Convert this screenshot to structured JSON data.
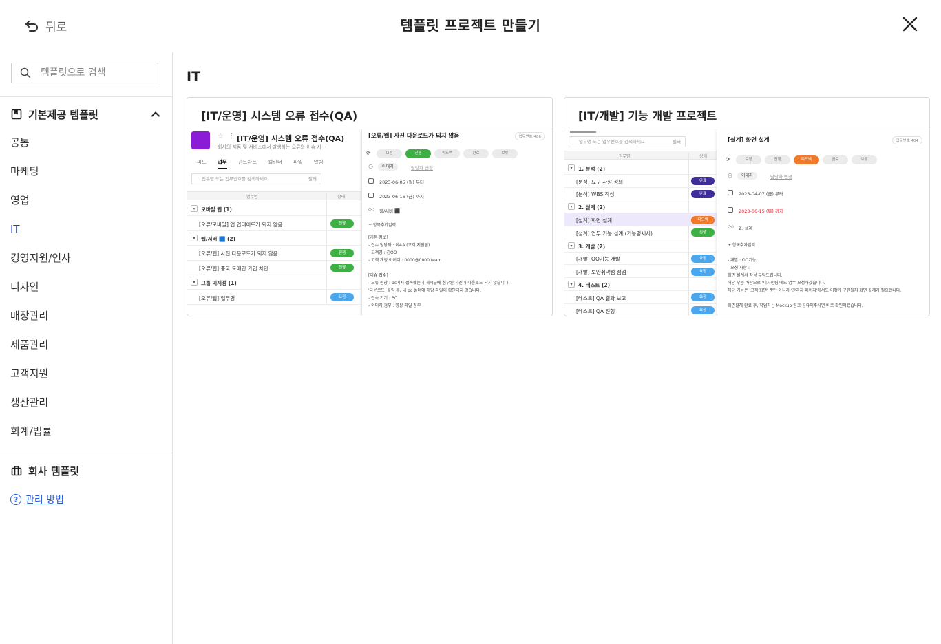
{
  "header": {
    "back_label": "뒤로",
    "title": "템플릿 프로젝트 만들기"
  },
  "sidebar": {
    "search_placeholder": "템플릿으로 검색",
    "builtin_section": "기본제공 템플릿",
    "categories": [
      "공통",
      "마케팅",
      "영업",
      "IT",
      "경영지원/인사",
      "디자인",
      "매장관리",
      "제품관리",
      "고객지원",
      "생산관리",
      "회계/법률"
    ],
    "active_category": "IT",
    "company_section": "회사 템플릿",
    "help_label": "관리 방법"
  },
  "main": {
    "heading": "IT",
    "cards": [
      {
        "title": "[IT/운영] 시스템 오류 접수(QA)",
        "preview": {
          "project_title": "[IT/운영] 시스템 오류 접수(QA)",
          "project_desc": "회사의 제품 및 서비스에서 발생하는 오류와 이슈 사···",
          "tabs": [
            "피드",
            "업무",
            "간트차트",
            "캘린더",
            "파일",
            "알림"
          ],
          "active_tab": "업무",
          "search_placeholder": "업무명 또는 업무번호를 검색하세요",
          "filter_label": "필터",
          "col_name": "업무명",
          "col_status": "상태",
          "rows": [
            {
              "kind": "group",
              "text": "모바일 웹 (1)"
            },
            {
              "kind": "task",
              "text": "[오류/모바일] 앱 업데이트가 되지 않음",
              "status": "진행",
              "color": "#3cb043"
            },
            {
              "kind": "group",
              "text": "웹/서버 🟦 (2)"
            },
            {
              "kind": "task",
              "text": "[오류/웹] 사진 다운로드가 되지 않음",
              "status": "진행",
              "color": "#3cb043"
            },
            {
              "kind": "task",
              "text": "[오류/웹] 중국 도메인 가입 차단",
              "status": "진행",
              "color": "#3cb043"
            },
            {
              "kind": "group",
              "text": "그룹 미지정 (1)"
            },
            {
              "kind": "task",
              "text": "[오류/웹] 업무명",
              "status": "요청",
              "color": "#4aa7ee"
            }
          ],
          "detail_title": "[오류/웹] 사진 다운로드가 되지 않음",
          "detail_num": "업무번호 486",
          "statuses": [
            "요청",
            "진행",
            "피드백",
            "완료",
            "보류"
          ],
          "active_status_index": 1,
          "active_status_color": "#3cb043",
          "assignee": "이대리",
          "assignee_add": "담당자 변경",
          "start_date": "2023-06-05 (월) 부터",
          "end_date": "2023-06-16 (금) 까지",
          "tag": "웹/서버 ⬛",
          "add_item": "+ 항목추가입력",
          "body": [
            "[기본 정보]",
            "- 접수 담당자 : 이AA (고객 지원팀)",
            "- 고객명 : 김OO",
            "- 고객 계정 아이디 : 0000@0000.team",
            "",
            "[이슈 접수]",
            "- 오류 현상 : pc에서 접속했는데 게시글에 첨부된 사진이 다운로드 되지 않습니다.",
            "  '다운로드' 클릭 후, 내 pc 폴더에 해당 파일이 확인되지 않습니다.",
            "- 접속 기기 : PC",
            "- 이미지 첨부 : 영상 파일 첨부"
          ]
        }
      },
      {
        "title": "[IT/개발] 기능 개발 프로젝트",
        "preview": {
          "search_placeholder": "업무명 또는 업무번호를 검색하세요",
          "filter_label": "필터",
          "col_name": "업무명",
          "col_status": "상태",
          "rows": [
            {
              "kind": "group",
              "text": "1. 분석 (2)"
            },
            {
              "kind": "task",
              "text": "[분석] 요구 사항 정의",
              "status": "완료",
              "color": "#3f2d9a"
            },
            {
              "kind": "task",
              "text": "[분석] WBS 작성",
              "status": "완료",
              "color": "#3f2d9a"
            },
            {
              "kind": "group",
              "text": "2. 설계 (2)"
            },
            {
              "kind": "task",
              "text": "[설계] 화면 설계",
              "status": "피드백",
              "color": "#f07a2a",
              "highlight": true
            },
            {
              "kind": "task",
              "text": "[설계] 업무 기능 설계 (기능명세서)",
              "status": "진행",
              "color": "#3cb043"
            },
            {
              "kind": "group",
              "text": "3. 개발 (2)"
            },
            {
              "kind": "task",
              "text": "[개발] OO기능 개발",
              "status": "요청",
              "color": "#4aa7ee"
            },
            {
              "kind": "task",
              "text": "[개발] 보안취약점 점검",
              "status": "요청",
              "color": "#4aa7ee"
            },
            {
              "kind": "group",
              "text": "4. 테스트 (2)"
            },
            {
              "kind": "task",
              "text": "[테스트] QA 결과 보고",
              "status": "요청",
              "color": "#4aa7ee"
            },
            {
              "kind": "task",
              "text": "[테스트] QA 진행",
              "status": "요청",
              "color": "#4aa7ee"
            }
          ],
          "detail_title": "[설계] 화면 설계",
          "detail_num": "업무번호 404",
          "statuses": [
            "요청",
            "진행",
            "피드백",
            "완료",
            "보류"
          ],
          "active_status_index": 2,
          "active_status_color": "#f07a2a",
          "assignee": "이대리",
          "assignee_add": "담당자 변경",
          "start_date": "2023-04-07 (금) 부터",
          "end_date": "2023-06-15 (목) 까지",
          "tag": "2. 설계",
          "add_item": "+ 항목추가입력",
          "body": [
            "- 개발 : OO기능",
            "- 요청 사항 :",
            "화면 설계서 작성 부탁드립니다.",
            "해당 부분 바탕으로 '디자인팀'에도 업무 요청하겠습니다.",
            "해당 기능은 '고객 화면' 뿐만 아니라 '관리자 페이지'에서도 어떻게 구현될지 화면 설계가 필요합니다.",
            "",
            "화면설계 완료 후, 작업하신 Mockup 링크 공유해주시면 바로 확인하겠습니다."
          ]
        }
      }
    ]
  },
  "colors": {
    "active_category": "#1a3fd6",
    "help_link": "#2a5bd7",
    "project_logo": "#8c1bd8"
  }
}
